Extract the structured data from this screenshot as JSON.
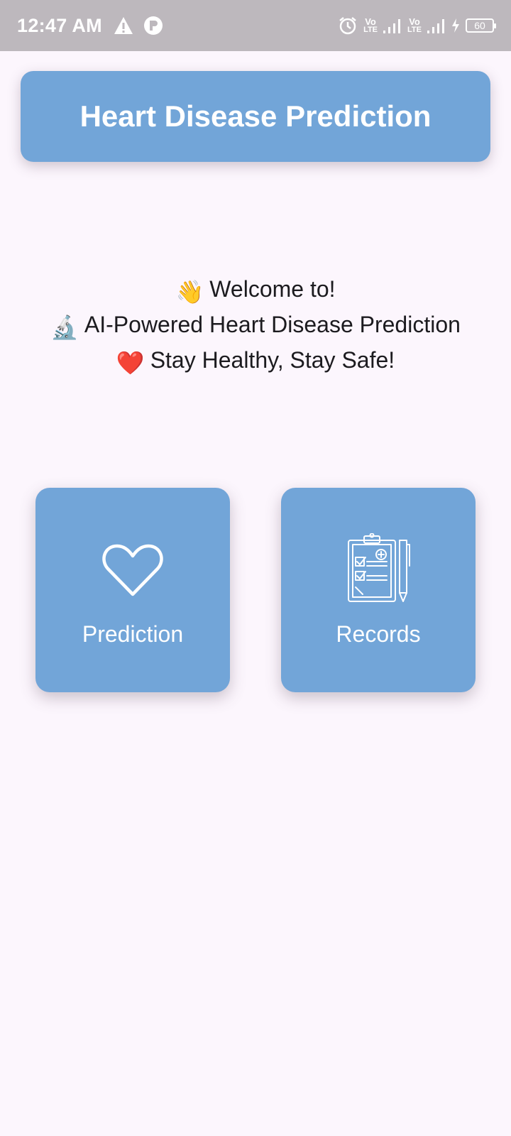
{
  "status_bar": {
    "time": "12:47 AM",
    "left_icons": [
      "warning-icon",
      "app-notification-icon"
    ],
    "right_icons": [
      "alarm-icon",
      "volte-signal-icon",
      "volte-signal-icon",
      "charging-icon"
    ],
    "volte_top": "Vo",
    "volte_bottom": "LTE",
    "battery_level": "60"
  },
  "header": {
    "title": "Heart Disease Prediction"
  },
  "welcome": {
    "line1_emoji": "👋",
    "line1_text": "Welcome to!",
    "line2_emoji": "🔬",
    "line2_text": "AI-Powered Heart Disease Prediction",
    "line3_emoji": "❤️",
    "line3_text": "Stay Healthy, Stay Safe!"
  },
  "tiles": {
    "prediction": {
      "label": "Prediction",
      "icon": "heart-outline-icon"
    },
    "records": {
      "label": "Records",
      "icon": "clipboard-checklist-icon"
    }
  },
  "colors": {
    "accent": "#72a5d8",
    "background": "#fcf6fd",
    "status_bar": "#bdb8bd",
    "text": "#1c1b1f"
  }
}
